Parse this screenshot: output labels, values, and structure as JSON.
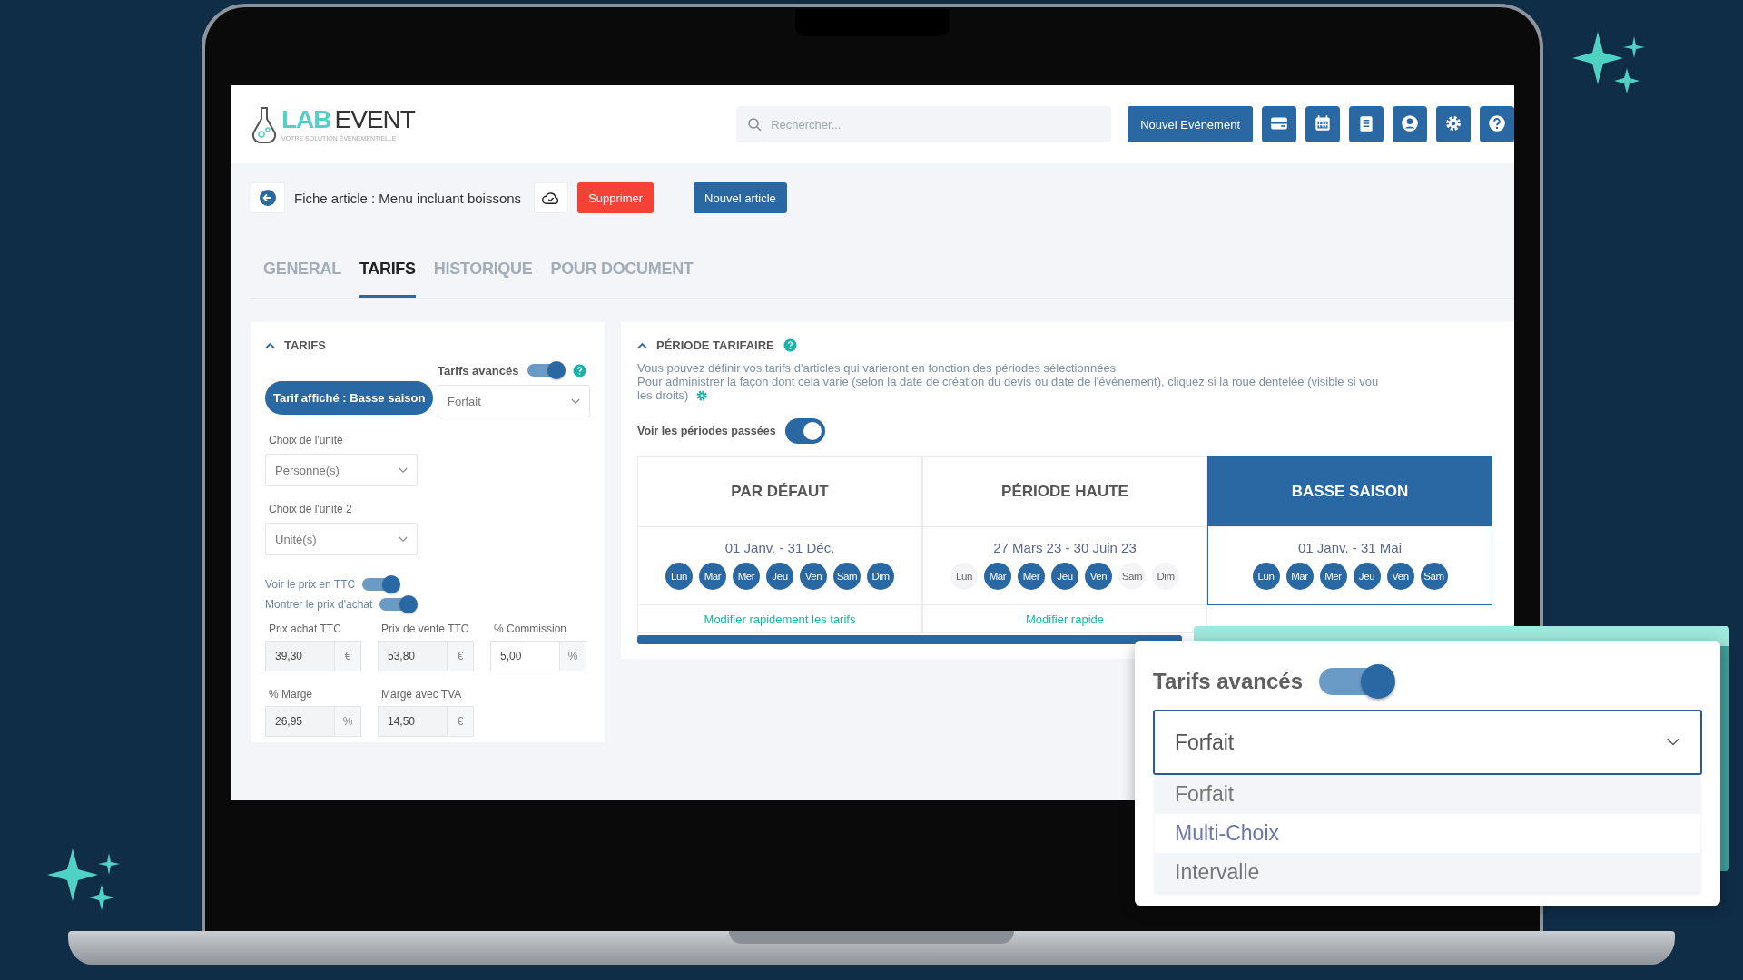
{
  "header": {
    "logo": {
      "part1": "LAB",
      "part2": "EVENT",
      "tagline": "VOTRE SOLUTION ÉVÉNEMENTIELLE"
    },
    "search": {
      "placeholder": "Rechercher..."
    },
    "new_event_button": "Nouvel Evénement"
  },
  "toolbar": {
    "title": "Fiche article : Menu incluant boissons",
    "delete_button": "Supprimer",
    "new_button": "Nouvel article"
  },
  "tabs": [
    {
      "label": "GENERAL",
      "selected": false
    },
    {
      "label": "TARIFS",
      "selected": true
    },
    {
      "label": "HISTORIQUE",
      "selected": false
    },
    {
      "label": "POUR DOCUMENT",
      "selected": false
    }
  ],
  "tarifs": {
    "title": "TARIFS",
    "displayed_badge": "Tarif affiché : Basse saison",
    "advanced": {
      "label": "Tarifs avancés",
      "on": true
    },
    "mode_select": "Forfait",
    "unit": {
      "label": "Choix de l'unité",
      "value": "Personne(s)"
    },
    "unit2": {
      "label": "Choix de l'unité 2",
      "value": "Unité(s)"
    },
    "toggles": [
      {
        "label": "Voir le prix en TTC",
        "on": true
      },
      {
        "label": "Montrer le prix d'achat",
        "on": true
      }
    ],
    "fields": [
      {
        "label": "Prix achat TTC",
        "value": "39,30",
        "unit": "€",
        "disabled": true
      },
      {
        "label": "Prix de vente TTC",
        "value": "53,80",
        "unit": "€",
        "disabled": true
      },
      {
        "label": "% Commission",
        "value": "5,00",
        "unit": "%",
        "disabled": false
      },
      {
        "label": "% Marge",
        "value": "26,95",
        "unit": "%",
        "disabled": true
      },
      {
        "label": "Marge avec TVA",
        "value": "14,50",
        "unit": "€",
        "disabled": true
      }
    ]
  },
  "periods": {
    "title": "PÉRIODE TARIFAIRE",
    "description": [
      "Vous pouvez définir vos tarifs d'articles qui varieront en fonction des périodes sélectionnées",
      "Pour administrer la façon dont cela varie (selon la date de création du devis ou date de l'événement), cliquez si la roue dentelée (visible si vou",
      "les droits)"
    ],
    "show_past": {
      "label": "Voir les périodes passées",
      "on": true
    },
    "cards": [
      {
        "name": "PAR DÉFAUT",
        "selected": false,
        "dates": "01 Janv. - 31 Déc.",
        "link": "Modifier rapidement les tarifs",
        "days": [
          {
            "label": "Lun",
            "on": true
          },
          {
            "label": "Mar",
            "on": true
          },
          {
            "label": "Mer",
            "on": true
          },
          {
            "label": "Jeu",
            "on": true
          },
          {
            "label": "Ven",
            "on": true
          },
          {
            "label": "Sam",
            "on": true
          },
          {
            "label": "Dim",
            "on": true
          }
        ]
      },
      {
        "name": "PÉRIODE HAUTE",
        "selected": false,
        "dates": "27 Mars 23 - 30 Juin 23",
        "link": "Modifier rapide",
        "days": [
          {
            "label": "Lun",
            "on": false
          },
          {
            "label": "Mar",
            "on": true
          },
          {
            "label": "Mer",
            "on": true
          },
          {
            "label": "Jeu",
            "on": true
          },
          {
            "label": "Ven",
            "on": true
          },
          {
            "label": "Sam",
            "on": false
          },
          {
            "label": "Dim",
            "on": false
          }
        ]
      },
      {
        "name": "BASSE SAISON",
        "selected": true,
        "dates": "01 Janv. - 31 Mai",
        "days": [
          {
            "label": "Lun",
            "on": true
          },
          {
            "label": "Mar",
            "on": true
          },
          {
            "label": "Mer",
            "on": true
          },
          {
            "label": "Jeu",
            "on": true
          },
          {
            "label": "Ven",
            "on": true
          },
          {
            "label": "Sam",
            "on": true
          }
        ]
      }
    ]
  },
  "popup": {
    "label": "Tarifs avancés",
    "on": true,
    "value": "Forfait",
    "options": [
      {
        "label": "Forfait",
        "highlighted": false
      },
      {
        "label": "Multi-Choix",
        "highlighted": true
      },
      {
        "label": "Intervalle",
        "highlighted": false
      }
    ]
  }
}
